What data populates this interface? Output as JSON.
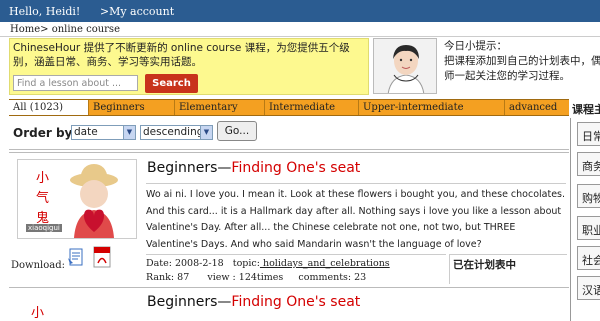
{
  "topbar": {
    "greeting": "Hello, Heidi!",
    "account": ">My account"
  },
  "breadcrumb": "Home> online course",
  "promo": {
    "text": "ChineseHour 提供了不断更新的 online course 课程，为您提供五个级别，涵盖日常、商务、学习等实用话题。",
    "search_placeholder": "Find a lesson about ...",
    "search_label": "Search"
  },
  "tips": {
    "title": "今日小提示：",
    "line1": "把课程添加到自己的计划表中，偶",
    "line2": "师一起关注您的学习过程。"
  },
  "tabs": [
    {
      "label": "All (1023)"
    },
    {
      "label": "Beginners"
    },
    {
      "label": "Elementary"
    },
    {
      "label": "Intermediate"
    },
    {
      "label": "Upper-intermediate"
    },
    {
      "label": "advanced"
    }
  ],
  "sidebar": {
    "title": "课程主",
    "items": [
      "日常",
      "商务",
      "购物",
      "职业",
      "社会",
      "汉语"
    ]
  },
  "order": {
    "label": "Order by:",
    "field": "date",
    "direction": "descending",
    "go": "Go..."
  },
  "lessons": [
    {
      "thumb_text": "小气鬼",
      "thumb_sub": "xiaoqigui",
      "title_level": "Beginners—",
      "title_name": "Finding One's seat",
      "desc": "Wo ai ni. I love you. I mean it. Look at these flowers i bought you, and these chocolates. And this card... it is a Hallmark day after all. Nothing says i love you like a lesson about Valentine's Day. After all... the Chinese celebrate not one, not two, but THREE Valentine's Days. And who said Mandarin wasn't the language of love?",
      "date_label": "Date:",
      "date": "2008-2-18",
      "topic_label": "topic:",
      "topic": " holidays_and_celebrations",
      "rank_label": "Rank:",
      "rank": "87",
      "view_label": "view :",
      "views": "124times",
      "comments_label": "comments:",
      "comments": "23",
      "plan": "已在计划表中",
      "download": "Download:"
    },
    {
      "thumb_text": "小气鬼",
      "title_level": "Beginners—",
      "title_name": "Finding One's seat"
    }
  ],
  "colors": {
    "topbar": "#2b5c91",
    "tabs": "#f4a021",
    "promo": "#fdf98f",
    "search": "#c8331b",
    "title_red": "#d40000"
  }
}
